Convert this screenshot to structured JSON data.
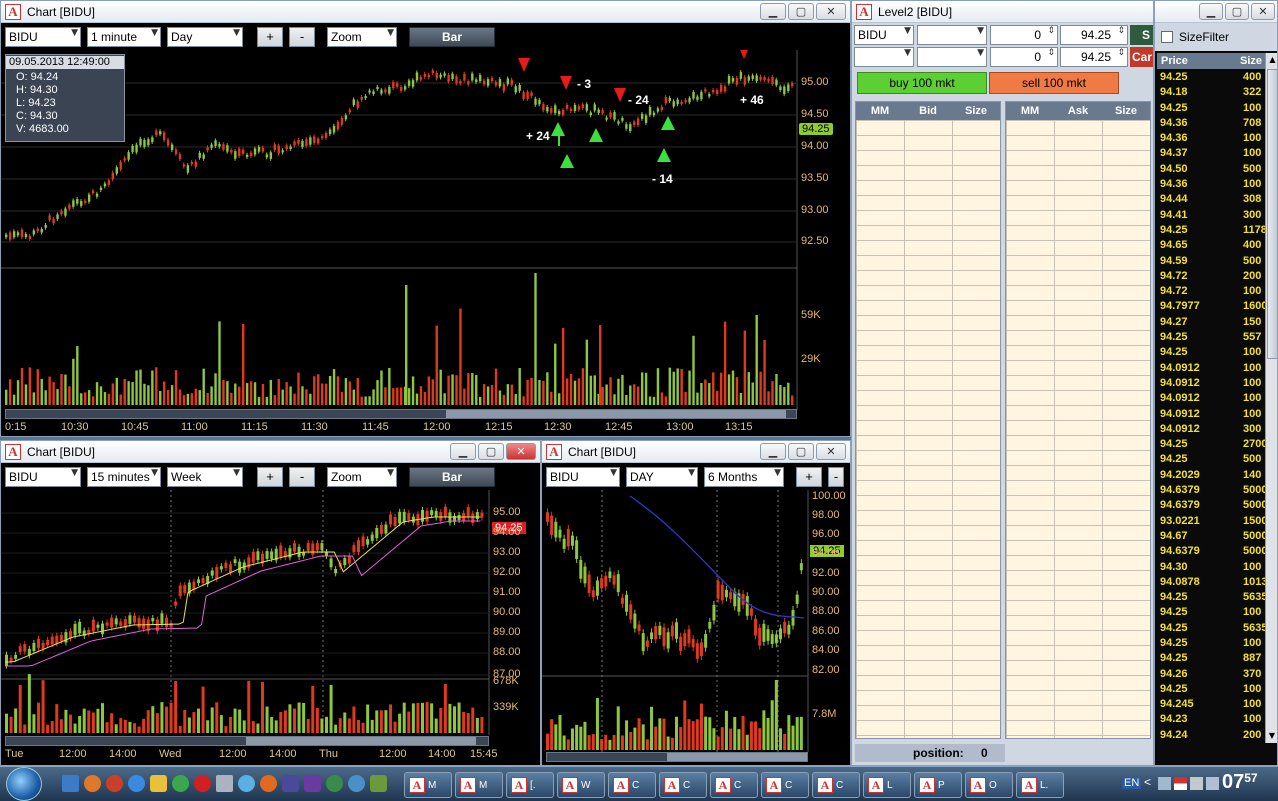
{
  "main_chart": {
    "title": "Chart [BIDU]",
    "symbol": "BIDU",
    "interval": "1 minute",
    "range": "Day",
    "plus": "+",
    "minus": "-",
    "zoom": "Zoom",
    "style": "Bar",
    "info": {
      "date": "09.05.2013 12:49:00",
      "o": "O: 94.24",
      "h": "H: 94.30",
      "l": "L: 94.23",
      "c": "C: 94.30",
      "v": "V: 4683.00"
    },
    "price_tag": "94.25",
    "y_ticks": [
      "95.00",
      "94.50",
      "94.00",
      "93.50",
      "93.00",
      "92.50"
    ],
    "vol_ticks": [
      "59K",
      "29K"
    ],
    "x_ticks": [
      "0:15",
      "10:30",
      "10:45",
      "11:00",
      "11:15",
      "11:30",
      "11:45",
      "12:00",
      "12:15",
      "12:30",
      "12:45",
      "13:00",
      "13:15"
    ],
    "annotations": [
      "- 3",
      "- 24",
      "+ 46",
      "+ 24",
      "- 14"
    ]
  },
  "level2": {
    "title": "Level2 [BIDU]",
    "symbol": "BIDU",
    "qty1": "0",
    "price1": "94.25",
    "qty2": "0",
    "price2": "94.25",
    "send_btn": "S",
    "cancel_btn": "Car",
    "buy_btn": "buy 100 mkt",
    "sell_btn": "sell 100 mkt",
    "bid_headers": [
      "MM",
      "Bid",
      "Size"
    ],
    "ask_headers": [
      "MM",
      "Ask",
      "Size"
    ],
    "position_label": "position:",
    "position_value": "0"
  },
  "size_filter": {
    "label": "SizeFilter",
    "headers": [
      "Price",
      "Size"
    ],
    "rows": [
      [
        "94.25",
        "400"
      ],
      [
        "94.18",
        "322"
      ],
      [
        "94.25",
        "100"
      ],
      [
        "94.36",
        "708"
      ],
      [
        "94.36",
        "100"
      ],
      [
        "94.37",
        "100"
      ],
      [
        "94.50",
        "500"
      ],
      [
        "94.36",
        "100"
      ],
      [
        "94.44",
        "308"
      ],
      [
        "94.41",
        "300"
      ],
      [
        "94.25",
        "1178"
      ],
      [
        "94.65",
        "400"
      ],
      [
        "94.59",
        "500"
      ],
      [
        "94.72",
        "200"
      ],
      [
        "94.72",
        "100"
      ],
      [
        "94.7977",
        "1600"
      ],
      [
        "94.27",
        "150"
      ],
      [
        "94.25",
        "557"
      ],
      [
        "94.25",
        "100"
      ],
      [
        "94.0912",
        "100"
      ],
      [
        "94.0912",
        "100"
      ],
      [
        "94.0912",
        "100"
      ],
      [
        "94.0912",
        "100"
      ],
      [
        "94.0912",
        "300"
      ],
      [
        "94.25",
        "2700"
      ],
      [
        "94.25",
        "500"
      ],
      [
        "94.2029",
        "140"
      ],
      [
        "94.6379",
        "5000"
      ],
      [
        "94.6379",
        "5000"
      ],
      [
        "93.0221",
        "1500"
      ],
      [
        "94.67",
        "5000"
      ],
      [
        "94.6379",
        "5000"
      ],
      [
        "94.30",
        "100"
      ],
      [
        "94.0878",
        "1013"
      ],
      [
        "94.25",
        "5635"
      ],
      [
        "94.25",
        "100"
      ],
      [
        "94.25",
        "5635"
      ],
      [
        "94.25",
        "100"
      ],
      [
        "94.25",
        "887"
      ],
      [
        "94.26",
        "370"
      ],
      [
        "94.25",
        "100"
      ],
      [
        "94.245",
        "100"
      ],
      [
        "94.23",
        "100"
      ],
      [
        "94.24",
        "200"
      ]
    ]
  },
  "chart_week": {
    "title": "Chart [BIDU]",
    "symbol": "BIDU",
    "interval": "15 minutes",
    "range": "Week",
    "plus": "+",
    "minus": "-",
    "zoom": "Zoom",
    "style": "Bar",
    "price_tag": "94.25",
    "y_ticks": [
      "95.00",
      "94.00",
      "93.00",
      "92.00",
      "91.00",
      "90.00",
      "89.00",
      "88.00",
      "87.00"
    ],
    "vol_ticks": [
      "678K",
      "339K"
    ],
    "x_ticks": [
      "Tue",
      "12:00",
      "14:00",
      "Wed",
      "12:00",
      "14:00",
      "Thu",
      "12:00",
      "14:00",
      "15:45"
    ]
  },
  "chart_day": {
    "title": "Chart [BIDU]",
    "symbol": "BIDU",
    "interval": "DAY",
    "range": "6 Months",
    "plus": "+",
    "minus": "-",
    "price_tag": "94.25",
    "y_ticks": [
      "100.00",
      "98.00",
      "96.00",
      "94.00",
      "92.00",
      "90.00",
      "88.00",
      "86.00",
      "84.00",
      "82.00"
    ],
    "vol_ticks": [
      "7.8M"
    ]
  },
  "taskbar": {
    "lang": "EN",
    "clock": "07",
    "clock_min": "57",
    "items": [
      "M",
      "M",
      "[.",
      "W",
      "C",
      "C",
      "C",
      "C",
      "C",
      "L",
      "P",
      "O",
      "L."
    ]
  }
}
